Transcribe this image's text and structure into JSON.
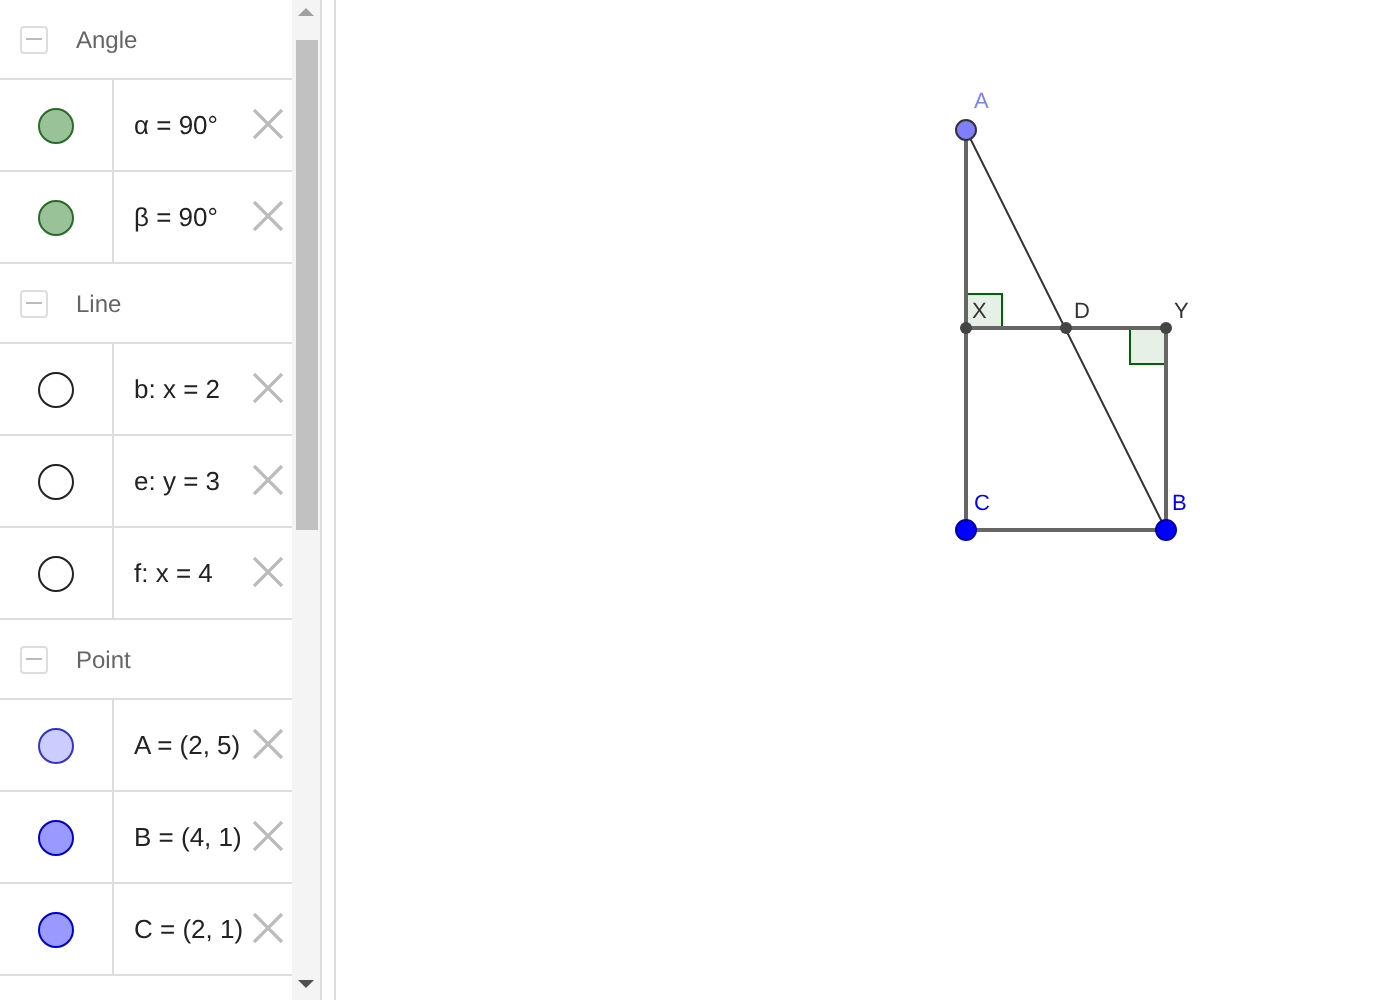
{
  "algebra_view": {
    "groups": [
      {
        "title": "Angle",
        "expanded": true,
        "items": [
          {
            "value": "α = 90°",
            "color": "#99c299",
            "filled": true
          },
          {
            "value": "β = 90°",
            "color": "#99c299",
            "filled": true
          }
        ]
      },
      {
        "title": "Line",
        "expanded": true,
        "items": [
          {
            "value": "b: x = 2",
            "color": "#ffffff",
            "filled": false
          },
          {
            "value": "e: y = 3",
            "color": "#ffffff",
            "filled": false
          },
          {
            "value": "f: x = 4",
            "color": "#ffffff",
            "filled": false
          }
        ]
      },
      {
        "title": "Point",
        "expanded": true,
        "items": [
          {
            "value": "A = (2, 5)",
            "color": "#ccccff",
            "filled": true
          },
          {
            "value": "B = (4, 1)",
            "color": "#9999ff",
            "filled": true
          },
          {
            "value": "C = (2, 1)",
            "color": "#9999ff",
            "filled": true
          }
        ]
      }
    ]
  },
  "graphics_view": {
    "labels": [
      {
        "text": "A",
        "color": "#7f7fff"
      },
      {
        "text": "X",
        "color": "#333333"
      },
      {
        "text": "D",
        "color": "#333333"
      },
      {
        "text": "Y",
        "color": "#333333"
      },
      {
        "text": "C",
        "color": "#0000ff"
      },
      {
        "text": "B",
        "color": "#0000ff"
      }
    ]
  }
}
